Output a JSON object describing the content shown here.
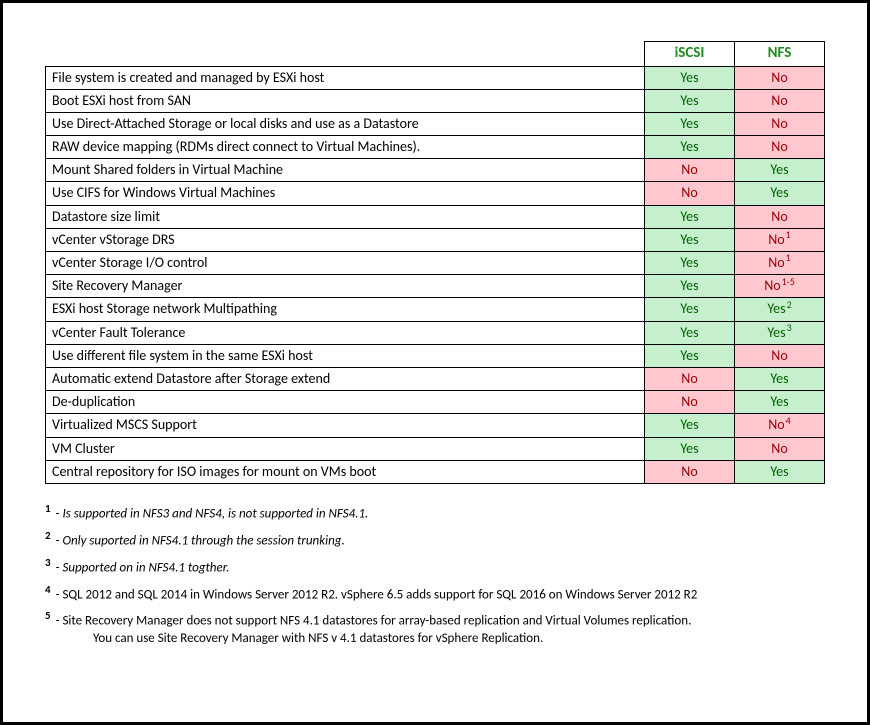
{
  "headers": {
    "col1": "iSCSI",
    "col2": "NFS"
  },
  "rows": [
    {
      "feature": "File system is created and managed by ESXi host",
      "iscsi": {
        "text": "Yes",
        "cls": "yes"
      },
      "nfs": {
        "text": "No",
        "cls": "no"
      }
    },
    {
      "feature": "Boot ESXi host from SAN",
      "iscsi": {
        "text": "Yes",
        "cls": "yes"
      },
      "nfs": {
        "text": "No",
        "cls": "no"
      }
    },
    {
      "feature": "Use Direct-Attached Storage or local disks and use as a Datastore",
      "iscsi": {
        "text": "Yes",
        "cls": "yes"
      },
      "nfs": {
        "text": "No",
        "cls": "no"
      }
    },
    {
      "feature": "RAW device mapping (RDMs direct connect to Virtual Machines).",
      "iscsi": {
        "text": "Yes",
        "cls": "yes"
      },
      "nfs": {
        "text": "No",
        "cls": "no"
      }
    },
    {
      "feature": "Mount Shared folders in Virtual Machine",
      "iscsi": {
        "text": "No",
        "cls": "no"
      },
      "nfs": {
        "text": "Yes",
        "cls": "yes"
      }
    },
    {
      "feature": "Use CIFS for Windows Virtual Machines",
      "iscsi": {
        "text": "No",
        "cls": "no"
      },
      "nfs": {
        "text": "Yes",
        "cls": "yes"
      }
    },
    {
      "feature": "Datastore size limit",
      "iscsi": {
        "text": "Yes",
        "cls": "yes"
      },
      "nfs": {
        "text": "No",
        "cls": "no"
      }
    },
    {
      "feature": "vCenter vStorage DRS",
      "iscsi": {
        "text": "Yes",
        "cls": "yes"
      },
      "nfs": {
        "text": "No",
        "sup": "1",
        "cls": "no"
      }
    },
    {
      "feature": "vCenter Storage I/O control",
      "iscsi": {
        "text": "Yes",
        "cls": "yes"
      },
      "nfs": {
        "text": "No",
        "sup": "1",
        "cls": "no"
      }
    },
    {
      "feature": "Site Recovery Manager",
      "iscsi": {
        "text": "Yes",
        "cls": "yes"
      },
      "nfs": {
        "text": "No",
        "sup": "1-5",
        "cls": "no"
      }
    },
    {
      "feature": "ESXi host Storage network Multipathing",
      "iscsi": {
        "text": "Yes",
        "cls": "yes"
      },
      "nfs": {
        "text": "Yes",
        "sup": "2",
        "cls": "yes"
      }
    },
    {
      "feature": "vCenter Fault Tolerance",
      "iscsi": {
        "text": "Yes",
        "cls": "yes"
      },
      "nfs": {
        "text": "Yes",
        "sup": "3",
        "cls": "yes"
      }
    },
    {
      "feature": "Use different file system in the same ESXi host",
      "iscsi": {
        "text": "Yes",
        "cls": "yes"
      },
      "nfs": {
        "text": "No",
        "cls": "no"
      }
    },
    {
      "feature": "Automatic extend Datastore after Storage extend",
      "iscsi": {
        "text": "No",
        "cls": "no"
      },
      "nfs": {
        "text": "Yes",
        "cls": "yes"
      }
    },
    {
      "feature": "De-duplication",
      "iscsi": {
        "text": "No",
        "cls": "no"
      },
      "nfs": {
        "text": "Yes",
        "cls": "yes"
      }
    },
    {
      "feature": "Virtualized MSCS Support",
      "iscsi": {
        "text": "Yes",
        "cls": "yes"
      },
      "nfs": {
        "text": "No",
        "sup": "4",
        "cls": "no"
      }
    },
    {
      "feature": "VM Cluster",
      "iscsi": {
        "text": "Yes",
        "cls": "yes"
      },
      "nfs": {
        "text": "No",
        "cls": "no"
      }
    },
    {
      "feature": "Central repository for ISO images for mount on VMs boot",
      "iscsi": {
        "text": "No",
        "cls": "no"
      },
      "nfs": {
        "text": "Yes",
        "cls": "yes"
      }
    }
  ],
  "footnotes": [
    {
      "num": "1",
      "text": "Is supported in NFS3 and NFS4, is not supported in NFS4.1.",
      "italic": true
    },
    {
      "num": "2",
      "text": "Only suported in NFS4.1 through the session trunking.",
      "italic": true
    },
    {
      "num": "3",
      "text": "Supported on in NFS4.1 togther.",
      "italic": true
    },
    {
      "num": "4",
      "text": "SQL 2012 and SQL 2014 in Windows Server 2012 R2. vSphere 6.5 adds support for SQL 2016 on Windows Server 2012 R2",
      "italic": false
    },
    {
      "num": "5",
      "text": "Site Recovery Manager does not support NFS 4.1 datastores for array-based replication and Virtual Volumes replication.",
      "cont": "You can use Site Recovery Manager with NFS v 4.1 datastores for vSphere Replication.",
      "italic": false
    }
  ]
}
